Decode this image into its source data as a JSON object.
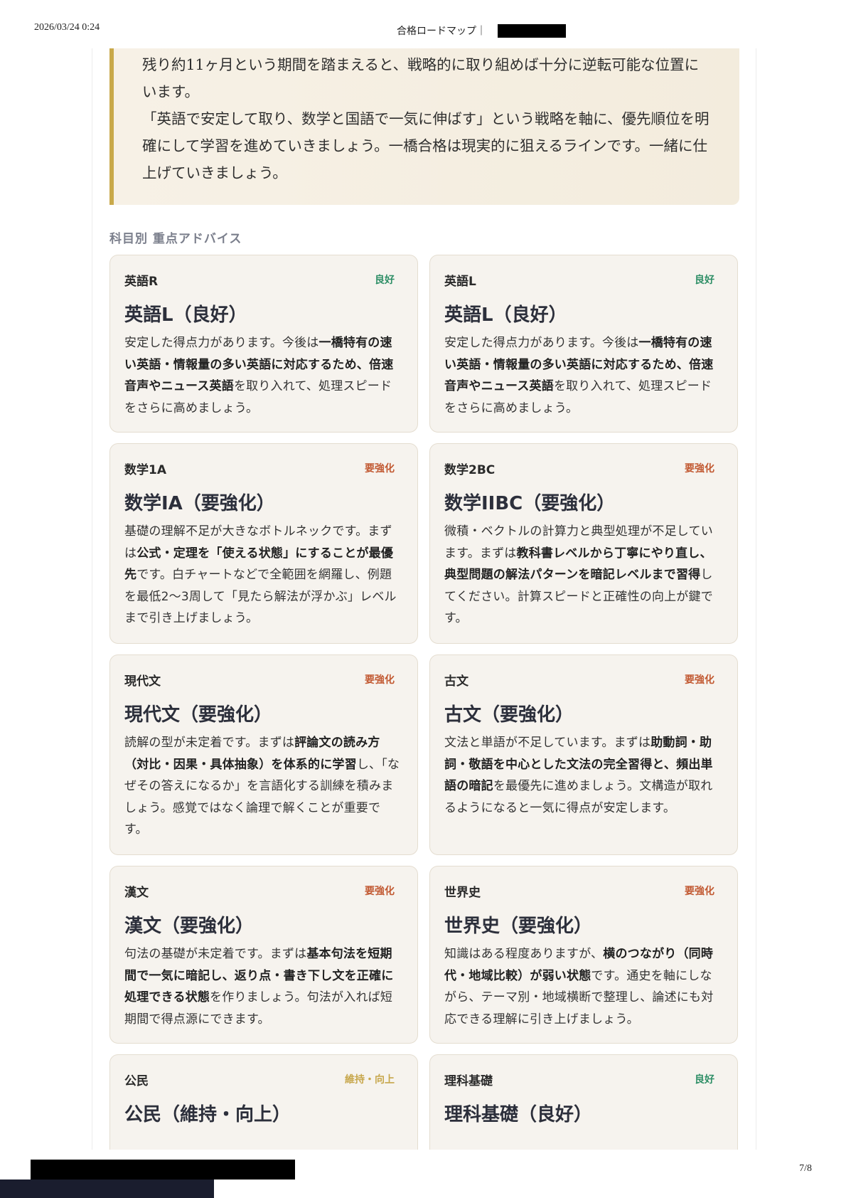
{
  "print_header": {
    "date": "2026/03/24 0:24",
    "title": "合格ロードマップ｜"
  },
  "page_number": "7/8",
  "summary": {
    "paragraphs": [
      "残り約11ヶ月という期間を踏まえると、戦略的に取り組めば十分に逆転可能な位置にいます。",
      "「英語で安定して取り、数学と国語で一気に伸ばす」という戦略を軸に、優先順位を明確にして学習を進めていきましょう。一橋合格は現実的に狙えるラインです。一緒に仕上げていきましょう。"
    ]
  },
  "section_title": "科目別 重点アドバイス",
  "cards": [
    {
      "subject": "英語R",
      "badge": "良好",
      "badge_type": "good",
      "title": "英語L（良好）",
      "body": [
        {
          "t": "安定した得点力があります。今後は",
          "b": false
        },
        {
          "t": "一橋特有の速い英語・情報量の多い英語に対応するため、倍速音声やニュース英語",
          "b": true
        },
        {
          "t": "を取り入れて、処理スピードをさらに高めましょう。",
          "b": false
        }
      ]
    },
    {
      "subject": "英語L",
      "badge": "良好",
      "badge_type": "good",
      "title": "英語L（良好）",
      "body": [
        {
          "t": "安定した得点力があります。今後は",
          "b": false
        },
        {
          "t": "一橋特有の速い英語・情報量の多い英語に対応するため、倍速音声やニュース英語",
          "b": true
        },
        {
          "t": "を取り入れて、処理スピードをさらに高めましょう。",
          "b": false
        }
      ]
    },
    {
      "subject": "数学1A",
      "badge": "要強化",
      "badge_type": "weak",
      "title": "数学IA（要強化）",
      "body": [
        {
          "t": "基礎の理解不足が大きなボトルネックです。まずは",
          "b": false
        },
        {
          "t": "公式・定理を「使える状態」にすることが最優先",
          "b": true
        },
        {
          "t": "です。白チャートなどで全範囲を網羅し、例題を最低2〜3周して「見たら解法が浮かぶ」レベルまで引き上げましょう。",
          "b": false
        }
      ]
    },
    {
      "subject": "数学2BC",
      "badge": "要強化",
      "badge_type": "weak",
      "title": "数学IIBC（要強化）",
      "body": [
        {
          "t": "微積・ベクトルの計算力と典型処理が不足しています。まずは",
          "b": false
        },
        {
          "t": "教科書レベルから丁寧にやり直し、典型問題の解法パターンを暗記レベルまで習得",
          "b": true
        },
        {
          "t": "してください。計算スピードと正確性の向上が鍵です。",
          "b": false
        }
      ]
    },
    {
      "subject": "現代文",
      "badge": "要強化",
      "badge_type": "weak",
      "title": "現代文（要強化）",
      "body": [
        {
          "t": "読解の型が未定着です。まずは",
          "b": false
        },
        {
          "t": "評論文の読み方（対比・因果・具体抽象）を体系的に学習",
          "b": true
        },
        {
          "t": "し、「なぜその答えになるか」を言語化する訓練を積みましょう。感覚ではなく論理で解くことが重要です。",
          "b": false
        }
      ]
    },
    {
      "subject": "古文",
      "badge": "要強化",
      "badge_type": "weak",
      "title": "古文（要強化）",
      "body": [
        {
          "t": "文法と単語が不足しています。まずは",
          "b": false
        },
        {
          "t": "助動詞・助詞・敬語を中心とした文法の完全習得と、頻出単語の暗記",
          "b": true
        },
        {
          "t": "を最優先に進めましょう。文構造が取れるようになると一気に得点が安定します。",
          "b": false
        }
      ]
    },
    {
      "subject": "漢文",
      "badge": "要強化",
      "badge_type": "weak",
      "title": "漢文（要強化）",
      "body": [
        {
          "t": "句法の基礎が未定着です。まずは",
          "b": false
        },
        {
          "t": "基本句法を短期間で一気に暗記し、返り点・書き下し文を正確に処理できる状態",
          "b": true
        },
        {
          "t": "を作りましょう。句法が入れば短期間で得点源にできます。",
          "b": false
        }
      ]
    },
    {
      "subject": "世界史",
      "badge": "要強化",
      "badge_type": "weak",
      "title": "世界史（要強化）",
      "body": [
        {
          "t": "知識はある程度ありますが、",
          "b": false
        },
        {
          "t": "横のつながり（同時代・地域比較）が弱い状態",
          "b": true
        },
        {
          "t": "です。通史を軸にしながら、テーマ別・地域横断で整理し、論述にも対応できる理解に引き上げましょう。",
          "b": false
        }
      ]
    },
    {
      "subject": "公民",
      "badge": "維持・向上",
      "badge_type": "maintain",
      "title": "公民（維持・向上）",
      "body": []
    },
    {
      "subject": "理科基礎",
      "badge": "良好",
      "badge_type": "good",
      "title": "理科基礎（良好）",
      "body": []
    }
  ]
}
